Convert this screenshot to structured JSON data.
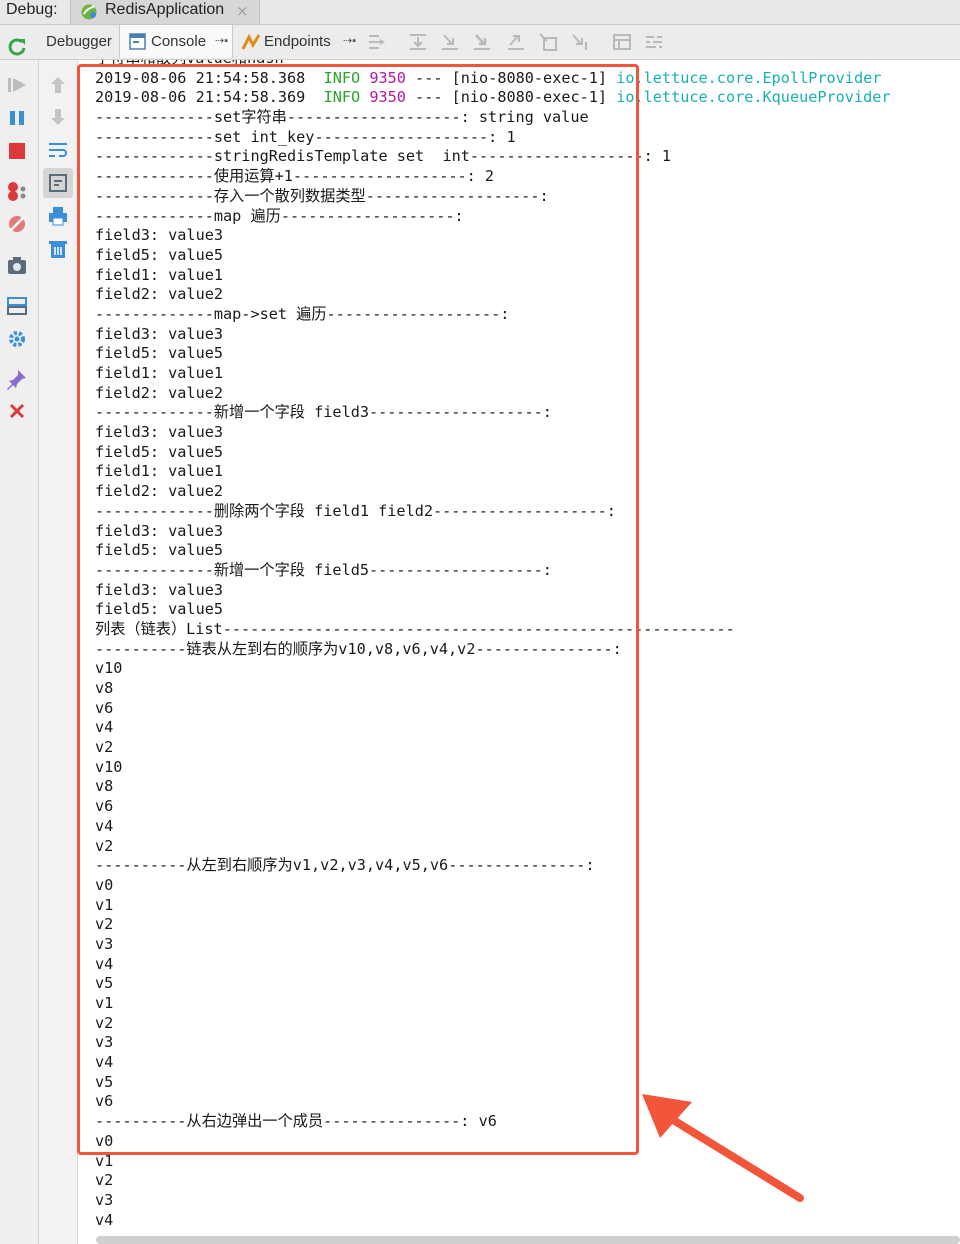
{
  "window": {
    "debug_label": "Debug:",
    "run_config": "RedisApplication",
    "close_glyph": "×"
  },
  "toolbar": {
    "tabs": [
      {
        "label": "Debugger"
      },
      {
        "label": "Console",
        "pin": "⇢▪"
      },
      {
        "label": "Endpoints",
        "pin": "⇢▪"
      }
    ]
  },
  "console": {
    "lines": [
      {
        "text": "字符串和散列value和hash-----------------------------------------------------------------"
      },
      {
        "parts": [
          {
            "text": "2019-08-06 21:54:58.368  "
          },
          {
            "text": "INFO",
            "cls": "c-info"
          },
          {
            "text": " "
          },
          {
            "text": "9350",
            "cls": "c-pid"
          },
          {
            "text": " --- [nio-8080-exec-1] "
          },
          {
            "text": "io.lettuce.core.EpollProvider",
            "cls": "c-cls"
          }
        ]
      },
      {
        "parts": [
          {
            "text": "2019-08-06 21:54:58.369  "
          },
          {
            "text": "INFO",
            "cls": "c-info"
          },
          {
            "text": " "
          },
          {
            "text": "9350",
            "cls": "c-pid"
          },
          {
            "text": " --- [nio-8080-exec-1] "
          },
          {
            "text": "io.lettuce.core.KqueueProvider",
            "cls": "c-cls"
          }
        ]
      },
      {
        "text": "-------------set字符串-------------------: string value"
      },
      {
        "text": "-------------set int_key-------------------: 1"
      },
      {
        "text": "-------------stringRedisTemplate set  int-------------------: 1"
      },
      {
        "text": "-------------使用运算+1-------------------: 2"
      },
      {
        "text": "-------------存入一个散列数据类型-------------------:"
      },
      {
        "text": "-------------map 遍历-------------------:"
      },
      {
        "text": "field3: value3"
      },
      {
        "text": "field5: value5"
      },
      {
        "text": "field1: value1"
      },
      {
        "text": "field2: value2"
      },
      {
        "text": "-------------map->set 遍历-------------------:"
      },
      {
        "text": "field3: value3"
      },
      {
        "text": "field5: value5"
      },
      {
        "text": "field1: value1"
      },
      {
        "text": "field2: value2"
      },
      {
        "text": "-------------新增一个字段 field3-------------------:"
      },
      {
        "text": "field3: value3"
      },
      {
        "text": "field5: value5"
      },
      {
        "text": "field1: value1"
      },
      {
        "text": "field2: value2"
      },
      {
        "text": "-------------删除两个字段 field1 field2-------------------:"
      },
      {
        "text": "field3: value3"
      },
      {
        "text": "field5: value5"
      },
      {
        "text": "-------------新增一个字段 field5-------------------:"
      },
      {
        "text": "field3: value3"
      },
      {
        "text": "field5: value5"
      },
      {
        "text": "列表（链表）List--------------------------------------------------------"
      },
      {
        "text": "----------链表从左到右的顺序为v10,v8,v6,v4,v2---------------:"
      },
      {
        "text": "v10"
      },
      {
        "text": "v8"
      },
      {
        "text": "v6"
      },
      {
        "text": "v4"
      },
      {
        "text": "v2"
      },
      {
        "text": "v10"
      },
      {
        "text": "v8"
      },
      {
        "text": "v6"
      },
      {
        "text": "v4"
      },
      {
        "text": "v2"
      },
      {
        "text": "----------从左到右顺序为v1,v2,v3,v4,v5,v6---------------:"
      },
      {
        "text": "v0"
      },
      {
        "text": "v1"
      },
      {
        "text": "v2"
      },
      {
        "text": "v3"
      },
      {
        "text": "v4"
      },
      {
        "text": "v5"
      },
      {
        "text": "v1"
      },
      {
        "text": "v2"
      },
      {
        "text": "v3"
      },
      {
        "text": "v4"
      },
      {
        "text": "v5"
      },
      {
        "text": "v6"
      },
      {
        "text": "----------从右边弹出一个成员---------------: v6"
      },
      {
        "text": "v0"
      },
      {
        "text": "v1"
      },
      {
        "text": "v2"
      },
      {
        "text": "v3"
      },
      {
        "text": "v4"
      }
    ]
  },
  "annotation": {
    "box_color": "#f2553a",
    "arrow_color": "#f2553a"
  },
  "colors": {
    "info": "#2aa52a",
    "pid": "#b3179f",
    "logger": "#1ab0b0"
  }
}
